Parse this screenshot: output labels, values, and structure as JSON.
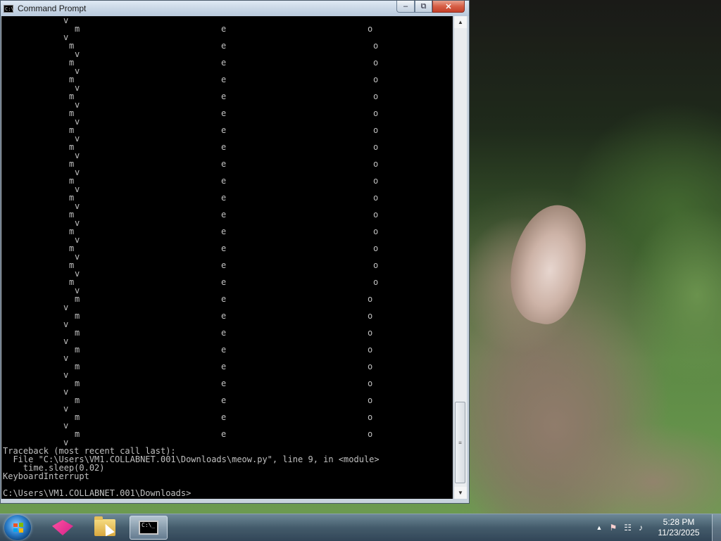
{
  "window": {
    "title": "Command Prompt",
    "minimize_glyph": "–",
    "maximize_glyph": "⧉",
    "close_glyph": "✕"
  },
  "console": {
    "animation_lines": [
      {
        "w": "",
        "m": "",
        "e": "",
        "o": "",
        "v": "v"
      },
      {
        "m": "m",
        "e": "e",
        "o": "o",
        "v": "",
        "variant": "A"
      },
      {
        "v": "v",
        "variant": "A"
      },
      {
        "m": "m",
        "e": "e",
        "o": "o",
        "variant": "B"
      },
      {
        "v": "v",
        "variant": "B"
      },
      {
        "m": "m",
        "e": "e",
        "o": "o",
        "variant": "B"
      },
      {
        "v": "v",
        "variant": "B"
      },
      {
        "m": "m",
        "e": "e",
        "o": "o",
        "variant": "B"
      },
      {
        "v": "v",
        "variant": "B"
      },
      {
        "m": "m",
        "e": "e",
        "o": "o",
        "variant": "B"
      },
      {
        "v": "v",
        "variant": "B"
      },
      {
        "m": "m",
        "e": "e",
        "o": "o",
        "variant": "B"
      },
      {
        "v": "v",
        "variant": "B"
      },
      {
        "m": "m",
        "e": "e",
        "o": "o",
        "variant": "B"
      },
      {
        "v": "v",
        "variant": "B"
      },
      {
        "m": "m",
        "e": "e",
        "o": "o",
        "variant": "B"
      },
      {
        "v": "v",
        "variant": "B"
      },
      {
        "m": "m",
        "e": "e",
        "o": "o",
        "variant": "B"
      },
      {
        "v": "v",
        "variant": "B"
      },
      {
        "m": "m",
        "e": "e",
        "o": "o",
        "variant": "B"
      },
      {
        "v": "v",
        "variant": "B"
      },
      {
        "m": "m",
        "e": "e",
        "o": "o",
        "variant": "B"
      },
      {
        "v": "v",
        "variant": "B"
      },
      {
        "m": "m",
        "e": "e",
        "o": "o",
        "variant": "B"
      },
      {
        "v": "v",
        "variant": "B"
      },
      {
        "m": "m",
        "e": "e",
        "o": "o",
        "variant": "B"
      },
      {
        "v": "v",
        "variant": "B"
      },
      {
        "m": "m",
        "e": "e",
        "o": "o",
        "variant": "B"
      },
      {
        "v": "v",
        "variant": "B"
      },
      {
        "m": "m",
        "e": "e",
        "o": "o",
        "variant": "B"
      },
      {
        "v": "v",
        "variant": "B"
      },
      {
        "m": "m",
        "e": "e",
        "o": "o",
        "variant": "B"
      },
      {
        "v": "v",
        "variant": "B"
      },
      {
        "m": "m",
        "e": "e",
        "o": "o",
        "variant": "A"
      },
      {
        "v": "v",
        "variant": "A"
      },
      {
        "m": "m",
        "e": "e",
        "o": "o",
        "variant": "A"
      },
      {
        "v": "v",
        "variant": "A"
      },
      {
        "m": "m",
        "e": "e",
        "o": "o",
        "variant": "A"
      },
      {
        "v": "v",
        "variant": "A"
      },
      {
        "m": "m",
        "e": "e",
        "o": "o",
        "variant": "A"
      },
      {
        "v": "v",
        "variant": "A"
      },
      {
        "m": "m",
        "e": "e",
        "o": "o",
        "variant": "A"
      },
      {
        "v": "v",
        "variant": "A"
      },
      {
        "m": "m",
        "e": "e",
        "o": "o",
        "variant": "A"
      },
      {
        "v": "v",
        "variant": "A"
      },
      {
        "m": "m",
        "e": "e",
        "o": "o",
        "variant": "A"
      },
      {
        "v": "v",
        "variant": "A"
      },
      {
        "m": "m",
        "e": "e",
        "o": "o",
        "variant": "A"
      },
      {
        "v": "v",
        "variant": "A"
      },
      {
        "m": "m",
        "e": "e",
        "o": "o",
        "variant": "A"
      },
      {
        "v": "v",
        "variant": "A"
      }
    ],
    "traceback_header": "Traceback (most recent call last):",
    "traceback_file": "  File \"C:\\Users\\VM1.COLLABNET.001\\Downloads\\meow.py\", line 9, in <module>",
    "traceback_code": "    time.sleep(0.02)",
    "exception": "KeyboardInterrupt",
    "prompt": "C:\\Users\\VM1.COLLABNET.001\\Downloads>"
  },
  "scrollbar": {
    "up_glyph": "▲",
    "down_glyph": "▼",
    "thumb_glyph": "≡"
  },
  "taskbar": {
    "cmd_icon_text": "C:\\_",
    "tray": {
      "show_hidden_glyph": "▲",
      "flag_glyph": "⚑",
      "network_glyph": "☷",
      "volume_glyph": "♪",
      "time": "5:28 PM",
      "date": "11/23/2025"
    }
  },
  "colors": {
    "console_bg": "#000000",
    "console_text": "#c0c0c0",
    "close_button": "#c4402a"
  }
}
